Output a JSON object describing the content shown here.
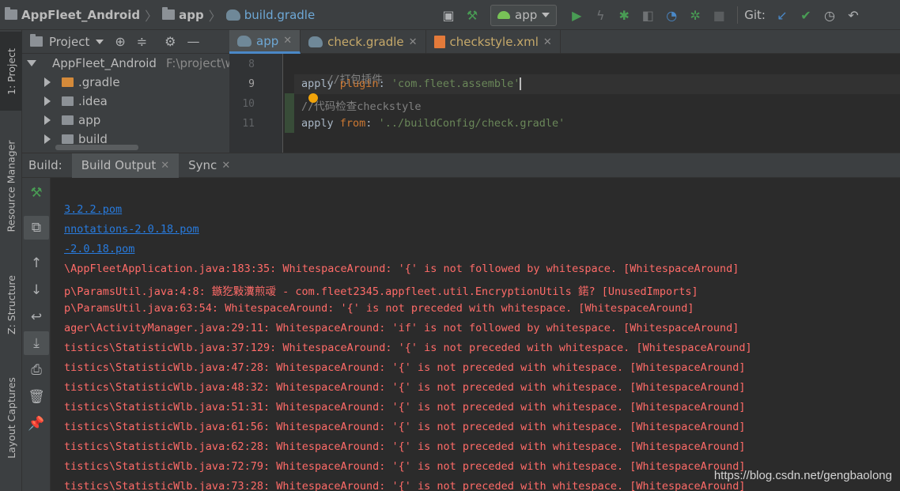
{
  "breadcrumb": {
    "project": "AppFleet_Android",
    "module": "app",
    "file": "build.gradle"
  },
  "toolbar": {
    "run_config": "app",
    "git_label": "Git:"
  },
  "left_tabs": {
    "project": "1: Project",
    "resource_manager": "Resource Manager",
    "structure": "Z: Structure",
    "layout_captures": "Layout Captures"
  },
  "project_panel": {
    "title": "Project",
    "root_name": "AppFleet_Android",
    "root_path": "F:\\project\\w",
    "items": [
      {
        "label": ".gradle"
      },
      {
        "label": ".idea"
      },
      {
        "label": "app"
      },
      {
        "label": "build"
      }
    ]
  },
  "editor": {
    "tabs": [
      {
        "label": "app"
      },
      {
        "label": "check.gradle"
      },
      {
        "label": "checkstyle.xml"
      }
    ],
    "line_numbers": [
      "8",
      "9",
      "10",
      "11"
    ],
    "lines": [
      {
        "a": "//打包插件"
      },
      {
        "a": "apply ",
        "b": "plugin",
        "c": ": ",
        "d": "'com.fleet.assemble'"
      },
      {
        "a": "/",
        "b": "/代码检查checkstyle"
      },
      {
        "a": "apply ",
        "b": "from",
        "c": ": ",
        "d": "'../buildConfig/check.gradle'"
      }
    ]
  },
  "build": {
    "label": "Build:",
    "tabs": [
      {
        "label": "Build Output"
      },
      {
        "label": "Sync"
      }
    ],
    "links": [
      "3.2.2.pom",
      "nnotations-2.0.18.pom",
      "-2.0.18.pom"
    ],
    "errors": [
      "\\AppFleetApplication.java:183:35: WhitespaceAround: '{' is not followed by whitespace. [WhitespaceAround]",
      "p\\ParamsUtil.java:4:8: 鏃犵敤瀵煎叆 - com.fleet2345.appfleet.util.EncryptionUtils 鍩? [UnusedImports]",
      "p\\ParamsUtil.java:63:54: WhitespaceAround: '{' is not preceded with whitespace. [WhitespaceAround]",
      "ager\\ActivityManager.java:29:11: WhitespaceAround: 'if' is not followed by whitespace. [WhitespaceAround]",
      "tistics\\StatisticWlb.java:37:129: WhitespaceAround: '{' is not preceded with whitespace. [WhitespaceAround]",
      "tistics\\StatisticWlb.java:47:28: WhitespaceAround: '{' is not preceded with whitespace. [WhitespaceAround]",
      "tistics\\StatisticWlb.java:48:32: WhitespaceAround: '{' is not preceded with whitespace. [WhitespaceAround]",
      "tistics\\StatisticWlb.java:51:31: WhitespaceAround: '{' is not preceded with whitespace. [WhitespaceAround]",
      "tistics\\StatisticWlb.java:61:56: WhitespaceAround: '{' is not preceded with whitespace. [WhitespaceAround]",
      "tistics\\StatisticWlb.java:62:28: WhitespaceAround: '{' is not preceded with whitespace. [WhitespaceAround]",
      "tistics\\StatisticWlb.java:72:79: WhitespaceAround: '{' is not preceded with whitespace. [WhitespaceAround]",
      "tistics\\StatisticWlb.java:73:28: WhitespaceAround: '{' is not preceded with whitespace. [WhitespaceAround]"
    ]
  },
  "watermark": "https://blog.csdn.net/gengbaolong",
  "colors": {
    "error": "#ff6b68",
    "link": "#287bde",
    "accent": "#4a88c7",
    "run": "#499c54"
  }
}
